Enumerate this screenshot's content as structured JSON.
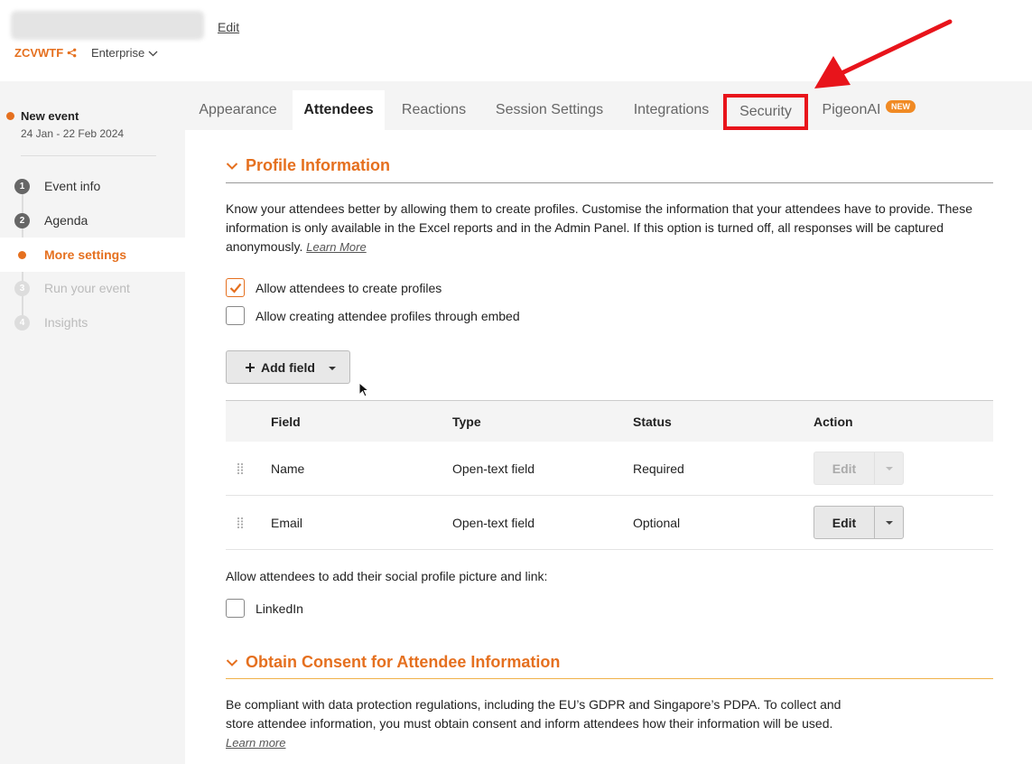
{
  "header": {
    "edit_label": "Edit",
    "event_code": "ZCVWTF",
    "plan_label": "Enterprise"
  },
  "sidebar": {
    "event_name": "New event",
    "event_dates": "24 Jan - 22 Feb 2024",
    "steps": [
      {
        "num": "1",
        "label": "Event info"
      },
      {
        "num": "2",
        "label": "Agenda"
      },
      {
        "num": "",
        "label": "More settings"
      },
      {
        "num": "3",
        "label": "Run your event"
      },
      {
        "num": "4",
        "label": "Insights"
      }
    ]
  },
  "tabs": [
    {
      "label": "Appearance"
    },
    {
      "label": "Attendees"
    },
    {
      "label": "Reactions"
    },
    {
      "label": "Session Settings"
    },
    {
      "label": "Integrations"
    },
    {
      "label": "Security"
    },
    {
      "label": "PigeonAI"
    }
  ],
  "new_badge": "NEW",
  "profile": {
    "title": "Profile Information",
    "description_1": "Know your attendees better by allowing them to create profiles. Customise the information that your attendees have to provide. These",
    "description_2": "information is only available in the Excel reports and in the Admin Panel. If this option is turned off, all responses will be captured",
    "description_3": "anonymously.",
    "learn_more": "Learn More",
    "allow_profiles": "Allow attendees to create profiles",
    "allow_embed": "Allow creating attendee profiles through embed",
    "add_field": "Add field"
  },
  "table": {
    "headers": [
      "Field",
      "Type",
      "Status",
      "Action"
    ],
    "rows": [
      {
        "field": "Name",
        "type": "Open-text field",
        "status": "Required",
        "action": "Edit"
      },
      {
        "field": "Email",
        "type": "Open-text field",
        "status": "Optional",
        "action": "Edit"
      }
    ]
  },
  "social": {
    "prompt": "Allow attendees to add their social profile picture and link:",
    "linkedin": "LinkedIn"
  },
  "consent": {
    "title": "Obtain Consent for Attendee Information",
    "line_1": "Be compliant with data protection regulations, including the EU’s GDPR and Singapore’s PDPA. To collect and",
    "line_2": "store attendee information, you must obtain consent and inform attendees how their information will be used.",
    "learn_more": "Learn more"
  },
  "colors": {
    "accent": "#e5701f",
    "highlight": "#e8141b"
  }
}
